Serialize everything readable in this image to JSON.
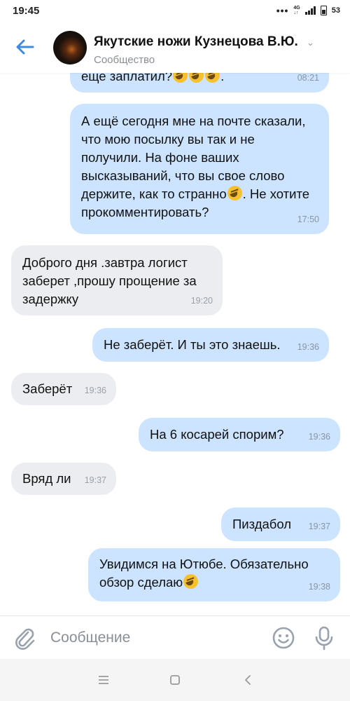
{
  "status_bar": {
    "time": "19:45",
    "dots": "•••",
    "network_top": "4G",
    "network_bottom": "↓↑",
    "battery": "53"
  },
  "header": {
    "title": "Якутские ножи Кузнецова В.Ю.",
    "subtitle": "Сообщество",
    "chevron": "⌄",
    "icons": {
      "back": "arrow-left-icon",
      "chevron": "chevron-down-icon"
    }
  },
  "messages": [
    {
      "dir": "out",
      "text": "еще заплатил?",
      "emoji_count": 3,
      "trailing": ".",
      "time": "08:21"
    },
    {
      "dir": "out",
      "text_before": "А ещё сегодня мне на почте сказали, что мою посылку вы так и не получили. На фоне ваших высказываний, что вы свое слово держите, как то странно",
      "text_after": ". Не хотите прокомментировать?",
      "time": "17:50"
    },
    {
      "dir": "in",
      "text": "Доброго дня .завтра логист заберет ,прошу прощение за задержку",
      "time": "19:20"
    },
    {
      "dir": "out",
      "text": "Не заберёт. И ты это знаешь.",
      "time": "19:36"
    },
    {
      "dir": "in",
      "text": "Заберёт",
      "time": "19:36"
    },
    {
      "dir": "out",
      "text": "На 6 косарей спорим?",
      "time": "19:36"
    },
    {
      "dir": "in",
      "text": "Вряд ли",
      "time": "19:37"
    },
    {
      "dir": "out",
      "text": "Пиздабол",
      "time": "19:37"
    },
    {
      "dir": "out",
      "text": "Увидимся на Ютюбе. Обязательно обзор сделаю",
      "time": "19:38"
    }
  ],
  "composer": {
    "placeholder": "Сообщение",
    "icons": {
      "attach": "paperclip-icon",
      "emoji": "smiley-icon",
      "mic": "microphone-icon"
    }
  },
  "navbar": {
    "icons": [
      "menu-icon",
      "home-square-icon",
      "back-chevron-icon"
    ]
  },
  "colors": {
    "accent": "#3f8ae0",
    "outgoing_bubble": "#cce4ff",
    "incoming_bubble": "#ebedf0",
    "timestamp": "#8a95a3",
    "emoji": "#f7c12e"
  }
}
